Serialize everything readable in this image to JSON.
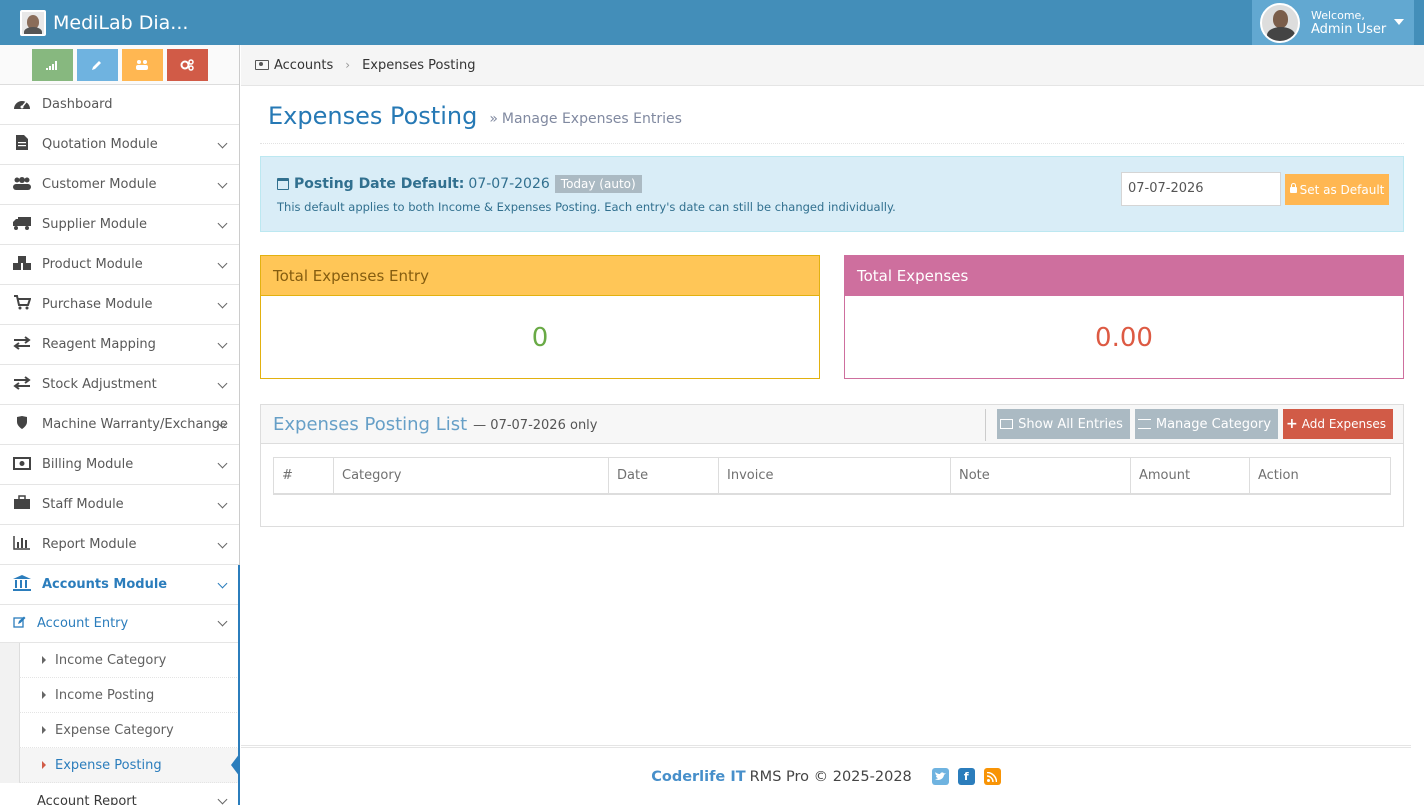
{
  "app": {
    "brand": "MediLab Dia...",
    "welcome": "Welcome,",
    "user": "Admin User"
  },
  "sidebar": {
    "items": [
      {
        "label": "Dashboard",
        "icon": "dashboard-icon"
      },
      {
        "label": "Quotation Module",
        "icon": "file-icon"
      },
      {
        "label": "Customer Module",
        "icon": "users-icon"
      },
      {
        "label": "Supplier Module",
        "icon": "truck-icon"
      },
      {
        "label": "Product Module",
        "icon": "cubes-icon"
      },
      {
        "label": "Purchase Module",
        "icon": "cart-icon"
      },
      {
        "label": "Reagent Mapping",
        "icon": "exchange-icon"
      },
      {
        "label": "Stock Adjustment",
        "icon": "exchange-icon"
      },
      {
        "label": "Machine Warranty/Exchange",
        "icon": "shield-icon"
      },
      {
        "label": "Billing Module",
        "icon": "money-icon"
      },
      {
        "label": "Staff Module",
        "icon": "briefcase-icon"
      },
      {
        "label": "Report Module",
        "icon": "bar-chart-icon"
      },
      {
        "label": "Accounts Module",
        "icon": "bank-icon"
      }
    ],
    "sub_entry": "Account Entry",
    "leaves": [
      "Income Category",
      "Income Posting",
      "Expense Category",
      "Expense Posting"
    ],
    "sub_report": "Account Report"
  },
  "breadcrumb": {
    "parent": "Accounts",
    "current": "Expenses Posting"
  },
  "page": {
    "title": "Expenses Posting",
    "subtitle": "Manage Expenses Entries"
  },
  "alert": {
    "label": "Posting Date Default:",
    "date": "07-07-2026",
    "badge": "Today (auto)",
    "note": "This default applies to both Income & Expenses Posting. Each entry's date can still be changed individually.",
    "input_value": "07-07-2026",
    "button": "Set as Default"
  },
  "stats": {
    "entries_label": "Total Expenses Entry",
    "entries_value": "0",
    "total_label": "Total Expenses",
    "total_value": "0.00"
  },
  "list": {
    "title": "Expenses Posting List",
    "subtitle": "— 07-07-2026 only",
    "btn_show_all": "Show All Entries",
    "btn_manage": "Manage Category",
    "btn_add": "Add Expenses",
    "columns": [
      "#",
      "Category",
      "Date",
      "Invoice",
      "Note",
      "Amount",
      "Action"
    ]
  },
  "footer": {
    "company": "Coderlife IT",
    "text": "RMS Pro © 2025-2028"
  },
  "colors": {
    "navbar": "#438eb9",
    "accent": "#2b7dbc",
    "warning": "#ffb752",
    "danger": "#d15b47",
    "pink": "#ce6f9e"
  }
}
